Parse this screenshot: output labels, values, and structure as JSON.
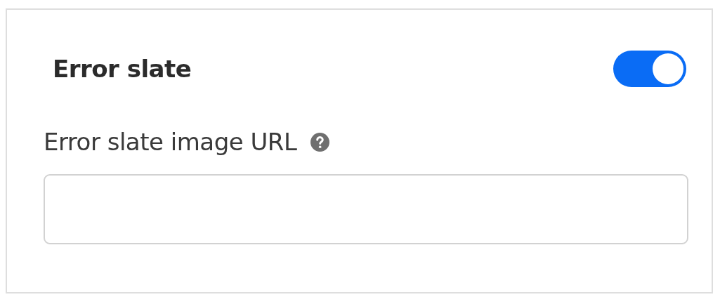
{
  "section": {
    "title": "Error slate",
    "enabled": true
  },
  "fields": [
    {
      "label": "Error slate image URL",
      "help_icon": true
    }
  ]
}
